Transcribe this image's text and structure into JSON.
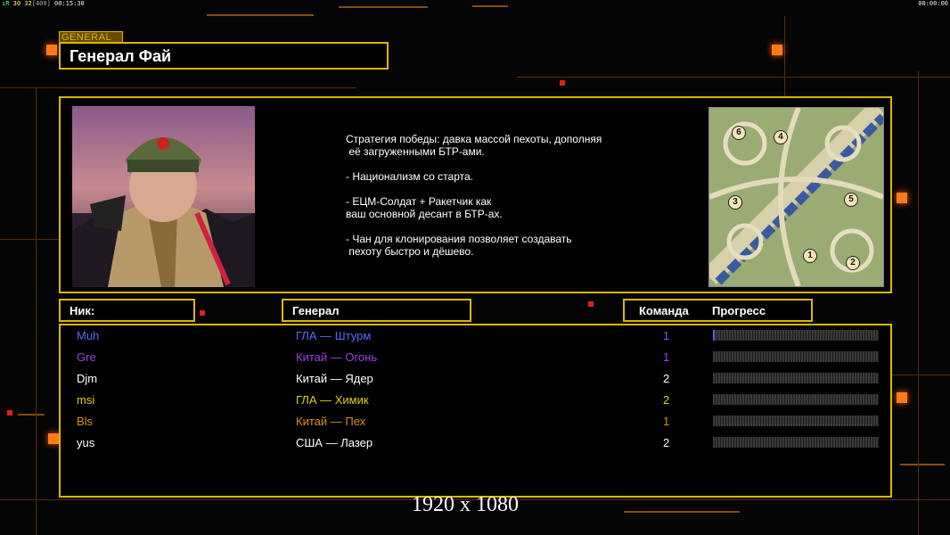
{
  "hud": {
    "left": "30 32",
    "left_bracket": "[400]",
    "left_time": "00:15:30",
    "right_time": "00:00:00",
    "left_prefix": "ıR"
  },
  "general_tag": "GENERAL",
  "title": "Генерал Фай",
  "description": "Стратегия победы: давка массой пехоты, дополняя\n её загруженными БТР-ами.\n\n- Национализм со старта.\n\n- ЕЦМ-Солдат + Ракетчик как\nваш основной десант в БТР-ах.\n\n- Чан для клонирования позволяет создавать\n пехоту быстро и дёшево.",
  "minimap": {
    "markers": [
      "6",
      "4",
      "3",
      "5",
      "1",
      "2"
    ]
  },
  "headers": {
    "nick": "Ник:",
    "general": "Генерал",
    "team": "Команда",
    "progress": "Прогресс"
  },
  "players": [
    {
      "nick": "Muh",
      "general": "ГЛА — Штурм",
      "team": "1",
      "color": "#5a6aff",
      "progress": 0.01
    },
    {
      "nick": "Gre",
      "general": "Китай — Огонь",
      "team": "1",
      "color": "#a040e0",
      "progress": 0
    },
    {
      "nick": "Djm",
      "general": "Китай — Ядер",
      "team": "2",
      "color": "#ffffff",
      "progress": 0
    },
    {
      "nick": "msi",
      "general": "ГЛА — Химик",
      "team": "2",
      "color": "#e0d020",
      "progress": 0
    },
    {
      "nick": "Bls",
      "general": "Китай — Пех",
      "team": "1",
      "color": "#e08a20",
      "progress": 0
    },
    {
      "nick": "yus",
      "general": "США — Лазер",
      "team": "2",
      "color": "#ffffff",
      "progress": 0
    }
  ],
  "resolution_label": "1920 x 1080",
  "colors": {
    "accent": "#d9b800",
    "orange": "#ff7a1a"
  }
}
